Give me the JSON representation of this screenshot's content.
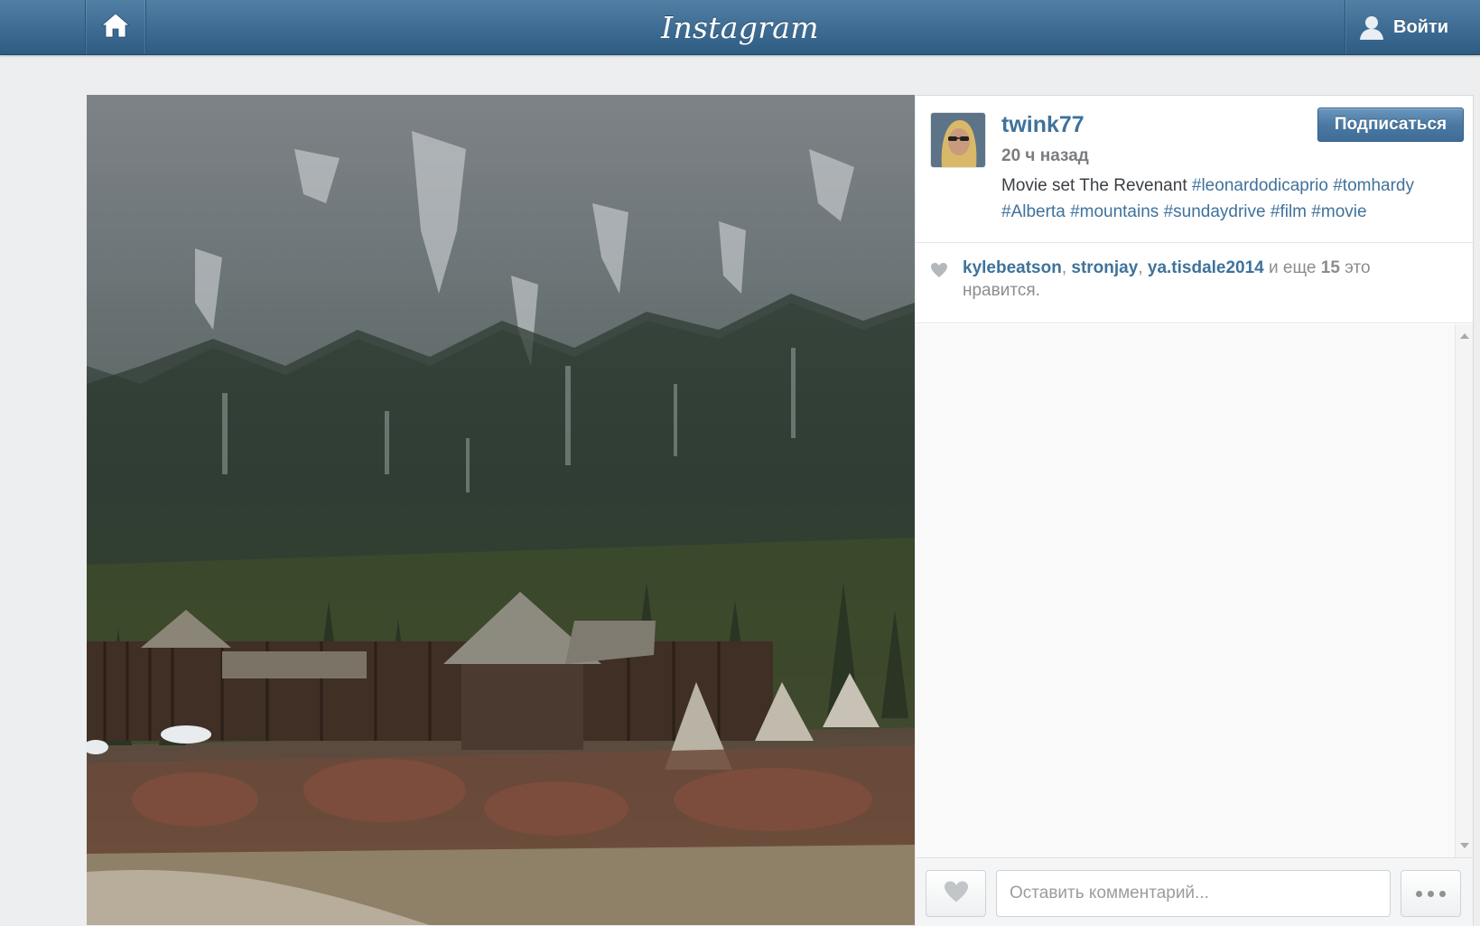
{
  "header": {
    "logo": "Instagram",
    "home_icon": "home-icon",
    "login_label": "Войти",
    "login_icon": "user-icon",
    "bar_color": "#3f729b"
  },
  "post": {
    "photo_description_icon": "photo",
    "author": {
      "username": "twink77",
      "avatar_icon": "avatar-image"
    },
    "time_ago": "20 ч назад",
    "follow_label": "Подписаться",
    "caption": {
      "text": "Movie set The Revenant",
      "hashtags": [
        "#leonardodicaprio",
        "#tomhardy",
        "#Alberta",
        "#mountains",
        "#sundaydrive",
        "#film",
        "#movie"
      ]
    },
    "likes": {
      "names": [
        "kylebeatson",
        "stronjay",
        "ya.tisdale2014"
      ],
      "separator": ", ",
      "more_prefix": " и еще ",
      "more_count": "15",
      "more_suffix": " это нравится."
    },
    "comment": {
      "placeholder": "Оставить комментарий..."
    }
  },
  "colors": {
    "link": "#3f729b",
    "muted": "#8a8d90"
  }
}
